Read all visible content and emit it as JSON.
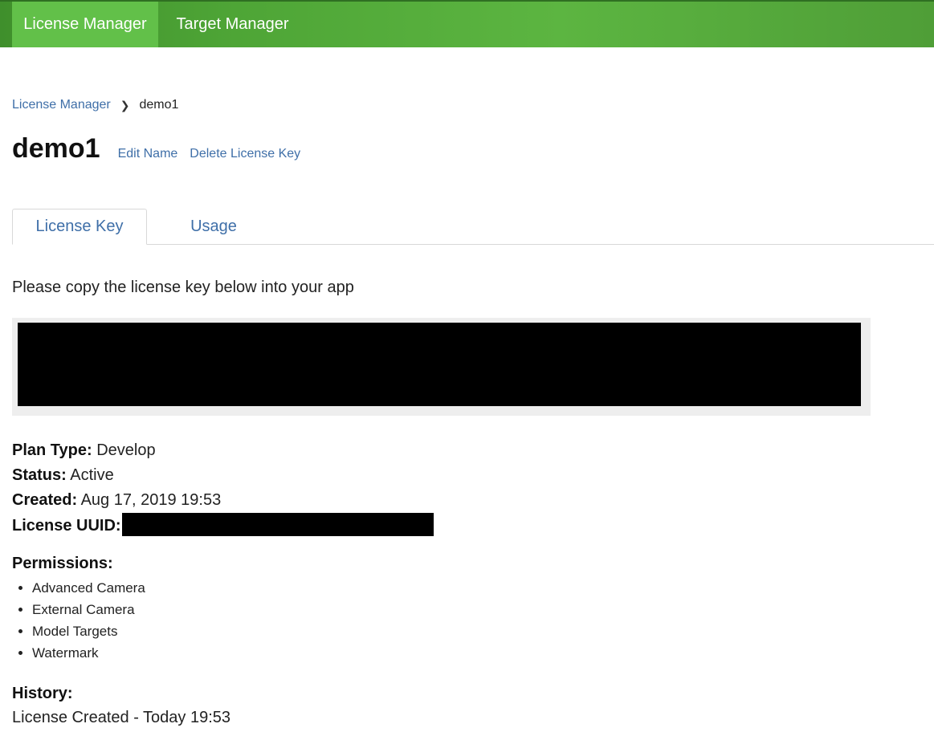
{
  "nav": {
    "tabs": [
      {
        "label": "License Manager",
        "active": true
      },
      {
        "label": "Target Manager",
        "active": false
      }
    ],
    "colors": {
      "bar": "#4ea536",
      "active_tab": "#62c049"
    }
  },
  "breadcrumb": {
    "parent": "License Manager",
    "separator_icon": "chevron-right-icon",
    "current": "demo1"
  },
  "header": {
    "title": "demo1",
    "edit_name": "Edit Name",
    "delete_key": "Delete License Key"
  },
  "tabs": [
    {
      "label": "License Key",
      "active": true
    },
    {
      "label": "Usage",
      "active": false
    }
  ],
  "license": {
    "instruction": "Please copy the license key below into your app",
    "key_redacted": true
  },
  "details": {
    "plan_type_label": "Plan Type:",
    "plan_type": "Develop",
    "status_label": "Status:",
    "status": "Active",
    "created_label": "Created:",
    "created": "Aug 17, 2019 19:53",
    "uuid_label": "License UUID:",
    "uuid_redacted": true
  },
  "permissions": {
    "heading": "Permissions:",
    "items": [
      "Advanced Camera",
      "External Camera",
      "Model Targets",
      "Watermark"
    ]
  },
  "history": {
    "heading": "History:",
    "entries": [
      "License Created - Today 19:53"
    ]
  },
  "colors": {
    "link": "#3f6fa8",
    "redaction": "#000000",
    "key_box_bg": "#eeeeee"
  }
}
